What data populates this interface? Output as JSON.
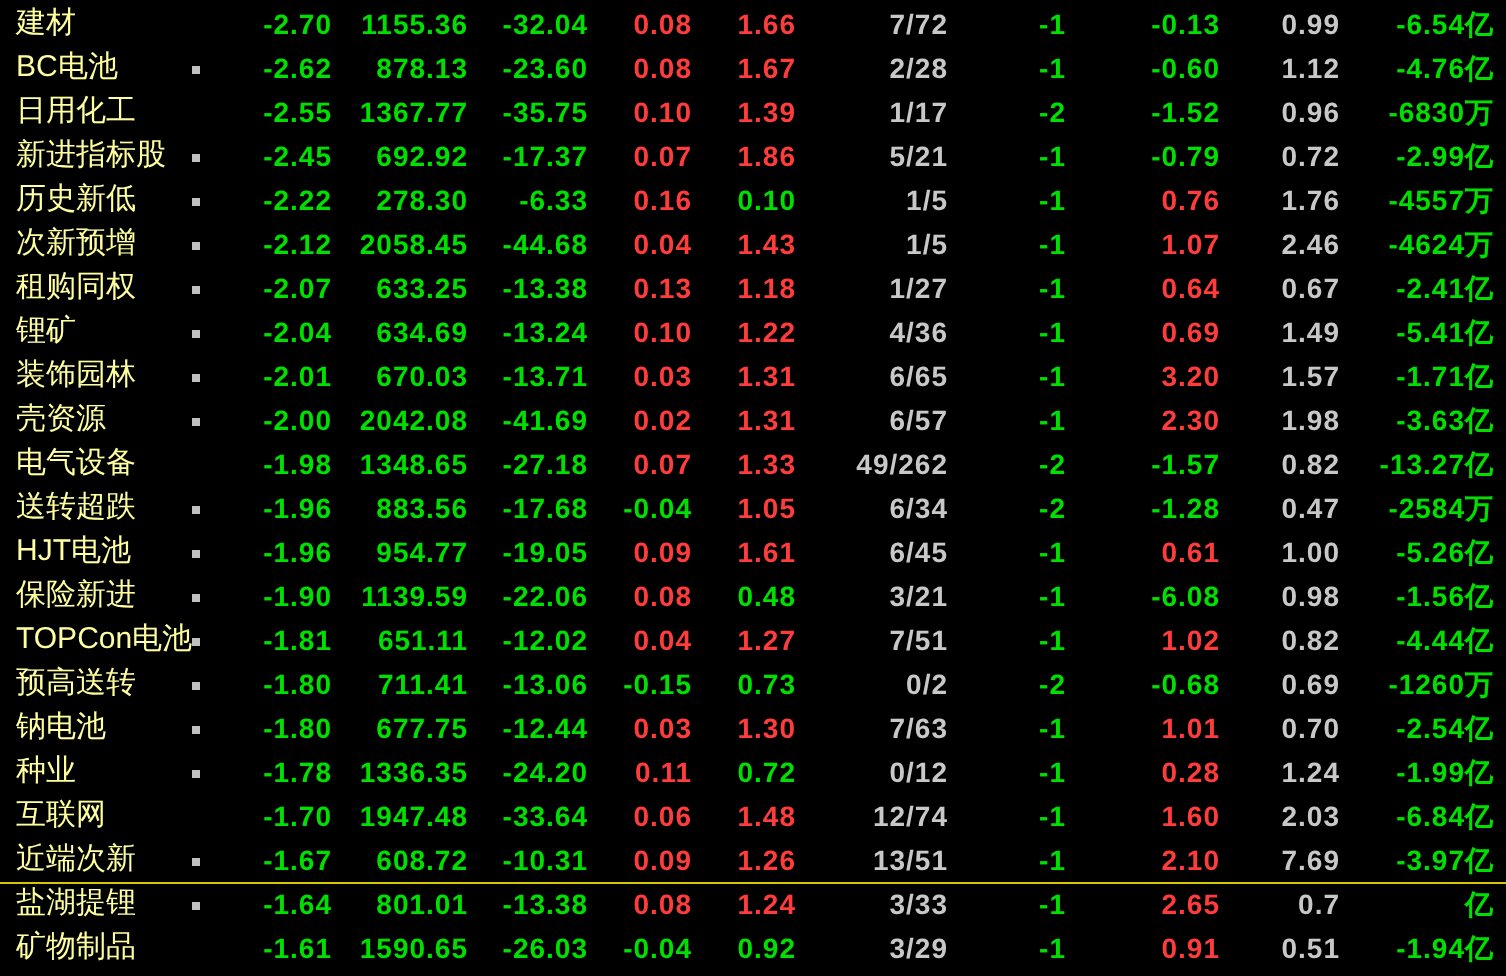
{
  "rows": [
    {
      "name": "建材",
      "marked": false,
      "line_below": false,
      "cells": [
        {
          "text": "-2.70",
          "color": "#00e000"
        },
        {
          "text": "1155.36",
          "color": "#00e000"
        },
        {
          "text": "-32.04",
          "color": "#00e000"
        },
        {
          "text": "0.08",
          "color": "#ff3c3c"
        },
        {
          "text": "1.66",
          "color": "#ff3c3c"
        },
        {
          "text": "7/72",
          "color": "#c8c8c8"
        },
        {
          "text": "-1",
          "color": "#00e000"
        },
        {
          "text": "-0.13",
          "color": "#00e000"
        },
        {
          "text": "0.99",
          "color": "#c8c8c8"
        },
        {
          "text": "-6.54亿",
          "color": "#00e000"
        }
      ]
    },
    {
      "name": "BC电池",
      "marked": true,
      "line_below": false,
      "cells": [
        {
          "text": "-2.62",
          "color": "#00e000"
        },
        {
          "text": "878.13",
          "color": "#00e000"
        },
        {
          "text": "-23.60",
          "color": "#00e000"
        },
        {
          "text": "0.08",
          "color": "#ff3c3c"
        },
        {
          "text": "1.67",
          "color": "#ff3c3c"
        },
        {
          "text": "2/28",
          "color": "#c8c8c8"
        },
        {
          "text": "-1",
          "color": "#00e000"
        },
        {
          "text": "-0.60",
          "color": "#00e000"
        },
        {
          "text": "1.12",
          "color": "#c8c8c8"
        },
        {
          "text": "-4.76亿",
          "color": "#00e000"
        }
      ]
    },
    {
      "name": "日用化工",
      "marked": false,
      "line_below": false,
      "cells": [
        {
          "text": "-2.55",
          "color": "#00e000"
        },
        {
          "text": "1367.77",
          "color": "#00e000"
        },
        {
          "text": "-35.75",
          "color": "#00e000"
        },
        {
          "text": "0.10",
          "color": "#ff3c3c"
        },
        {
          "text": "1.39",
          "color": "#ff3c3c"
        },
        {
          "text": "1/17",
          "color": "#c8c8c8"
        },
        {
          "text": "-2",
          "color": "#00e000"
        },
        {
          "text": "-1.52",
          "color": "#00e000"
        },
        {
          "text": "0.96",
          "color": "#c8c8c8"
        },
        {
          "text": "-6830万",
          "color": "#00e000"
        }
      ]
    },
    {
      "name": "新进指标股",
      "marked": true,
      "line_below": false,
      "cells": [
        {
          "text": "-2.45",
          "color": "#00e000"
        },
        {
          "text": "692.92",
          "color": "#00e000"
        },
        {
          "text": "-17.37",
          "color": "#00e000"
        },
        {
          "text": "0.07",
          "color": "#ff3c3c"
        },
        {
          "text": "1.86",
          "color": "#ff3c3c"
        },
        {
          "text": "5/21",
          "color": "#c8c8c8"
        },
        {
          "text": "-1",
          "color": "#00e000"
        },
        {
          "text": "-0.79",
          "color": "#00e000"
        },
        {
          "text": "0.72",
          "color": "#c8c8c8"
        },
        {
          "text": "-2.99亿",
          "color": "#00e000"
        }
      ]
    },
    {
      "name": "历史新低",
      "marked": true,
      "line_below": false,
      "cells": [
        {
          "text": "-2.22",
          "color": "#00e000"
        },
        {
          "text": "278.30",
          "color": "#00e000"
        },
        {
          "text": "-6.33",
          "color": "#00e000"
        },
        {
          "text": "0.16",
          "color": "#ff3c3c"
        },
        {
          "text": "0.10",
          "color": "#00e000"
        },
        {
          "text": "1/5",
          "color": "#c8c8c8"
        },
        {
          "text": "-1",
          "color": "#00e000"
        },
        {
          "text": "0.76",
          "color": "#ff3c3c"
        },
        {
          "text": "1.76",
          "color": "#c8c8c8"
        },
        {
          "text": "-4557万",
          "color": "#00e000"
        }
      ]
    },
    {
      "name": "次新预增",
      "marked": true,
      "line_below": false,
      "cells": [
        {
          "text": "-2.12",
          "color": "#00e000"
        },
        {
          "text": "2058.45",
          "color": "#00e000"
        },
        {
          "text": "-44.68",
          "color": "#00e000"
        },
        {
          "text": "0.04",
          "color": "#ff3c3c"
        },
        {
          "text": "1.43",
          "color": "#ff3c3c"
        },
        {
          "text": "1/5",
          "color": "#c8c8c8"
        },
        {
          "text": "-1",
          "color": "#00e000"
        },
        {
          "text": "1.07",
          "color": "#ff3c3c"
        },
        {
          "text": "2.46",
          "color": "#c8c8c8"
        },
        {
          "text": "-4624万",
          "color": "#00e000"
        }
      ]
    },
    {
      "name": "租购同权",
      "marked": true,
      "line_below": false,
      "cells": [
        {
          "text": "-2.07",
          "color": "#00e000"
        },
        {
          "text": "633.25",
          "color": "#00e000"
        },
        {
          "text": "-13.38",
          "color": "#00e000"
        },
        {
          "text": "0.13",
          "color": "#ff3c3c"
        },
        {
          "text": "1.18",
          "color": "#ff3c3c"
        },
        {
          "text": "1/27",
          "color": "#c8c8c8"
        },
        {
          "text": "-1",
          "color": "#00e000"
        },
        {
          "text": "0.64",
          "color": "#ff3c3c"
        },
        {
          "text": "0.67",
          "color": "#c8c8c8"
        },
        {
          "text": "-2.41亿",
          "color": "#00e000"
        }
      ]
    },
    {
      "name": "锂矿",
      "marked": true,
      "line_below": false,
      "cells": [
        {
          "text": "-2.04",
          "color": "#00e000"
        },
        {
          "text": "634.69",
          "color": "#00e000"
        },
        {
          "text": "-13.24",
          "color": "#00e000"
        },
        {
          "text": "0.10",
          "color": "#ff3c3c"
        },
        {
          "text": "1.22",
          "color": "#ff3c3c"
        },
        {
          "text": "4/36",
          "color": "#c8c8c8"
        },
        {
          "text": "-1",
          "color": "#00e000"
        },
        {
          "text": "0.69",
          "color": "#ff3c3c"
        },
        {
          "text": "1.49",
          "color": "#c8c8c8"
        },
        {
          "text": "-5.41亿",
          "color": "#00e000"
        }
      ]
    },
    {
      "name": "装饰园林",
      "marked": true,
      "line_below": false,
      "cells": [
        {
          "text": "-2.01",
          "color": "#00e000"
        },
        {
          "text": "670.03",
          "color": "#00e000"
        },
        {
          "text": "-13.71",
          "color": "#00e000"
        },
        {
          "text": "0.03",
          "color": "#ff3c3c"
        },
        {
          "text": "1.31",
          "color": "#ff3c3c"
        },
        {
          "text": "6/65",
          "color": "#c8c8c8"
        },
        {
          "text": "-1",
          "color": "#00e000"
        },
        {
          "text": "3.20",
          "color": "#ff3c3c"
        },
        {
          "text": "1.57",
          "color": "#c8c8c8"
        },
        {
          "text": "-1.71亿",
          "color": "#00e000"
        }
      ]
    },
    {
      "name": "壳资源",
      "marked": true,
      "line_below": false,
      "cells": [
        {
          "text": "-2.00",
          "color": "#00e000"
        },
        {
          "text": "2042.08",
          "color": "#00e000"
        },
        {
          "text": "-41.69",
          "color": "#00e000"
        },
        {
          "text": "0.02",
          "color": "#ff3c3c"
        },
        {
          "text": "1.31",
          "color": "#ff3c3c"
        },
        {
          "text": "6/57",
          "color": "#c8c8c8"
        },
        {
          "text": "-1",
          "color": "#00e000"
        },
        {
          "text": "2.30",
          "color": "#ff3c3c"
        },
        {
          "text": "1.98",
          "color": "#c8c8c8"
        },
        {
          "text": "-3.63亿",
          "color": "#00e000"
        }
      ]
    },
    {
      "name": "电气设备",
      "marked": false,
      "line_below": false,
      "cells": [
        {
          "text": "-1.98",
          "color": "#00e000"
        },
        {
          "text": "1348.65",
          "color": "#00e000"
        },
        {
          "text": "-27.18",
          "color": "#00e000"
        },
        {
          "text": "0.07",
          "color": "#ff3c3c"
        },
        {
          "text": "1.33",
          "color": "#ff3c3c"
        },
        {
          "text": "49/262",
          "color": "#c8c8c8"
        },
        {
          "text": "-2",
          "color": "#00e000"
        },
        {
          "text": "-1.57",
          "color": "#00e000"
        },
        {
          "text": "0.82",
          "color": "#c8c8c8"
        },
        {
          "text": "-13.27亿",
          "color": "#00e000"
        }
      ]
    },
    {
      "name": "送转超跌",
      "marked": true,
      "line_below": false,
      "cells": [
        {
          "text": "-1.96",
          "color": "#00e000"
        },
        {
          "text": "883.56",
          "color": "#00e000"
        },
        {
          "text": "-17.68",
          "color": "#00e000"
        },
        {
          "text": "-0.04",
          "color": "#00e000"
        },
        {
          "text": "1.05",
          "color": "#ff3c3c"
        },
        {
          "text": "6/34",
          "color": "#c8c8c8"
        },
        {
          "text": "-2",
          "color": "#00e000"
        },
        {
          "text": "-1.28",
          "color": "#00e000"
        },
        {
          "text": "0.47",
          "color": "#c8c8c8"
        },
        {
          "text": "-2584万",
          "color": "#00e000"
        }
      ]
    },
    {
      "name": "HJT电池",
      "marked": true,
      "line_below": false,
      "cells": [
        {
          "text": "-1.96",
          "color": "#00e000"
        },
        {
          "text": "954.77",
          "color": "#00e000"
        },
        {
          "text": "-19.05",
          "color": "#00e000"
        },
        {
          "text": "0.09",
          "color": "#ff3c3c"
        },
        {
          "text": "1.61",
          "color": "#ff3c3c"
        },
        {
          "text": "6/45",
          "color": "#c8c8c8"
        },
        {
          "text": "-1",
          "color": "#00e000"
        },
        {
          "text": "0.61",
          "color": "#ff3c3c"
        },
        {
          "text": "1.00",
          "color": "#c8c8c8"
        },
        {
          "text": "-5.26亿",
          "color": "#00e000"
        }
      ]
    },
    {
      "name": "保险新进",
      "marked": true,
      "line_below": false,
      "cells": [
        {
          "text": "-1.90",
          "color": "#00e000"
        },
        {
          "text": "1139.59",
          "color": "#00e000"
        },
        {
          "text": "-22.06",
          "color": "#00e000"
        },
        {
          "text": "0.08",
          "color": "#ff3c3c"
        },
        {
          "text": "0.48",
          "color": "#00e000"
        },
        {
          "text": "3/21",
          "color": "#c8c8c8"
        },
        {
          "text": "-1",
          "color": "#00e000"
        },
        {
          "text": "-6.08",
          "color": "#00e000"
        },
        {
          "text": "0.98",
          "color": "#c8c8c8"
        },
        {
          "text": "-1.56亿",
          "color": "#00e000"
        }
      ]
    },
    {
      "name": "TOPCon电池",
      "marked": true,
      "line_below": false,
      "cells": [
        {
          "text": "-1.81",
          "color": "#00e000"
        },
        {
          "text": "651.11",
          "color": "#00e000"
        },
        {
          "text": "-12.02",
          "color": "#00e000"
        },
        {
          "text": "0.04",
          "color": "#ff3c3c"
        },
        {
          "text": "1.27",
          "color": "#ff3c3c"
        },
        {
          "text": "7/51",
          "color": "#c8c8c8"
        },
        {
          "text": "-1",
          "color": "#00e000"
        },
        {
          "text": "1.02",
          "color": "#ff3c3c"
        },
        {
          "text": "0.82",
          "color": "#c8c8c8"
        },
        {
          "text": "-4.44亿",
          "color": "#00e000"
        }
      ]
    },
    {
      "name": "预高送转",
      "marked": true,
      "line_below": false,
      "cells": [
        {
          "text": "-1.80",
          "color": "#00e000"
        },
        {
          "text": "711.41",
          "color": "#00e000"
        },
        {
          "text": "-13.06",
          "color": "#00e000"
        },
        {
          "text": "-0.15",
          "color": "#00e000"
        },
        {
          "text": "0.73",
          "color": "#00e000"
        },
        {
          "text": "0/2",
          "color": "#c8c8c8"
        },
        {
          "text": "-2",
          "color": "#00e000"
        },
        {
          "text": "-0.68",
          "color": "#00e000"
        },
        {
          "text": "0.69",
          "color": "#c8c8c8"
        },
        {
          "text": "-1260万",
          "color": "#00e000"
        }
      ]
    },
    {
      "name": "钠电池",
      "marked": true,
      "line_below": false,
      "cells": [
        {
          "text": "-1.80",
          "color": "#00e000"
        },
        {
          "text": "677.75",
          "color": "#00e000"
        },
        {
          "text": "-12.44",
          "color": "#00e000"
        },
        {
          "text": "0.03",
          "color": "#ff3c3c"
        },
        {
          "text": "1.30",
          "color": "#ff3c3c"
        },
        {
          "text": "7/63",
          "color": "#c8c8c8"
        },
        {
          "text": "-1",
          "color": "#00e000"
        },
        {
          "text": "1.01",
          "color": "#ff3c3c"
        },
        {
          "text": "0.70",
          "color": "#c8c8c8"
        },
        {
          "text": "-2.54亿",
          "color": "#00e000"
        }
      ]
    },
    {
      "name": "种业",
      "marked": true,
      "line_below": false,
      "cells": [
        {
          "text": "-1.78",
          "color": "#00e000"
        },
        {
          "text": "1336.35",
          "color": "#00e000"
        },
        {
          "text": "-24.20",
          "color": "#00e000"
        },
        {
          "text": "0.11",
          "color": "#ff3c3c"
        },
        {
          "text": "0.72",
          "color": "#00e000"
        },
        {
          "text": "0/12",
          "color": "#c8c8c8"
        },
        {
          "text": "-1",
          "color": "#00e000"
        },
        {
          "text": "0.28",
          "color": "#ff3c3c"
        },
        {
          "text": "1.24",
          "color": "#c8c8c8"
        },
        {
          "text": "-1.99亿",
          "color": "#00e000"
        }
      ]
    },
    {
      "name": "互联网",
      "marked": false,
      "line_below": false,
      "cells": [
        {
          "text": "-1.70",
          "color": "#00e000"
        },
        {
          "text": "1947.48",
          "color": "#00e000"
        },
        {
          "text": "-33.64",
          "color": "#00e000"
        },
        {
          "text": "0.06",
          "color": "#ff3c3c"
        },
        {
          "text": "1.48",
          "color": "#ff3c3c"
        },
        {
          "text": "12/74",
          "color": "#c8c8c8"
        },
        {
          "text": "-1",
          "color": "#00e000"
        },
        {
          "text": "1.60",
          "color": "#ff3c3c"
        },
        {
          "text": "2.03",
          "color": "#c8c8c8"
        },
        {
          "text": "-6.84亿",
          "color": "#00e000"
        }
      ]
    },
    {
      "name": "近端次新",
      "marked": true,
      "line_below": true,
      "cells": [
        {
          "text": "-1.67",
          "color": "#00e000"
        },
        {
          "text": "608.72",
          "color": "#00e000"
        },
        {
          "text": "-10.31",
          "color": "#00e000"
        },
        {
          "text": "0.09",
          "color": "#ff3c3c"
        },
        {
          "text": "1.26",
          "color": "#ff3c3c"
        },
        {
          "text": "13/51",
          "color": "#c8c8c8"
        },
        {
          "text": "-1",
          "color": "#00e000"
        },
        {
          "text": "2.10",
          "color": "#ff3c3c"
        },
        {
          "text": "7.69",
          "color": "#c8c8c8"
        },
        {
          "text": "-3.97亿",
          "color": "#00e000"
        }
      ]
    },
    {
      "name": "盐湖提锂",
      "marked": true,
      "line_below": false,
      "cells": [
        {
          "text": "-1.64",
          "color": "#00e000"
        },
        {
          "text": "801.01",
          "color": "#00e000"
        },
        {
          "text": "-13.38",
          "color": "#00e000"
        },
        {
          "text": "0.08",
          "color": "#ff3c3c"
        },
        {
          "text": "1.24",
          "color": "#ff3c3c"
        },
        {
          "text": "3/33",
          "color": "#c8c8c8"
        },
        {
          "text": "-1",
          "color": "#00e000"
        },
        {
          "text": "2.65",
          "color": "#ff3c3c"
        },
        {
          "text": "0.7",
          "color": "#c8c8c8"
        },
        {
          "text": "亿",
          "color": "#00e000"
        }
      ]
    },
    {
      "name": "矿物制品",
      "marked": false,
      "line_below": false,
      "cells": [
        {
          "text": "-1.61",
          "color": "#00e000"
        },
        {
          "text": "1590.65",
          "color": "#00e000"
        },
        {
          "text": "-26.03",
          "color": "#00e000"
        },
        {
          "text": "-0.04",
          "color": "#00e000"
        },
        {
          "text": "0.92",
          "color": "#00e000"
        },
        {
          "text": "3/29",
          "color": "#c8c8c8"
        },
        {
          "text": "-1",
          "color": "#00e000"
        },
        {
          "text": "0.91",
          "color": "#ff3c3c"
        },
        {
          "text": "0.51",
          "color": "#c8c8c8"
        },
        {
          "text": "-1.94亿",
          "color": "#00e000"
        }
      ]
    }
  ]
}
